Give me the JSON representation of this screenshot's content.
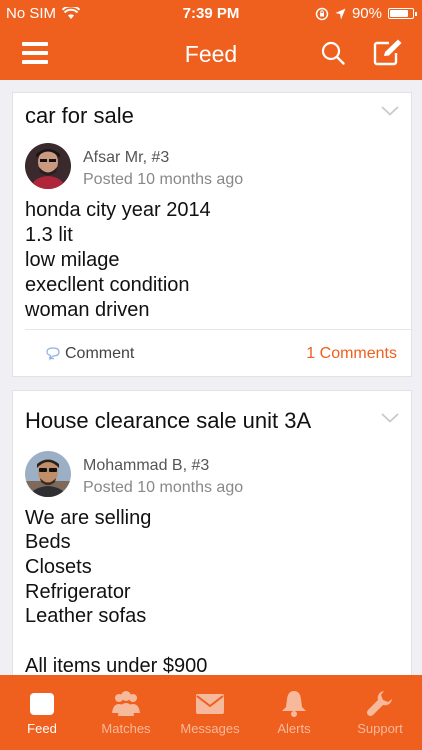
{
  "status": {
    "carrier": "No SIM",
    "time": "7:39 PM",
    "battery": "90%",
    "battery_level": 0.9
  },
  "nav": {
    "title": "Feed"
  },
  "posts": [
    {
      "title": "car for sale",
      "author": "Afsar Mr, #3",
      "posted": "Posted 10 months ago",
      "body": [
        "honda city year 2014",
        "1.3 lit",
        "low milage",
        "execllent condition",
        "woman driven"
      ],
      "comment_label": "Comment",
      "comments_count": "1 Comments"
    },
    {
      "title": "House clearance sale unit 3A",
      "author": "Mohammad B, #3",
      "posted": "Posted 10 months ago",
      "body": [
        "We are selling",
        "Beds",
        "Closets",
        "Refrigerator",
        "Leather sofas",
        "",
        "All items under $900"
      ]
    }
  ],
  "tabs": [
    {
      "label": "Feed",
      "icon": "feed-icon",
      "active": true
    },
    {
      "label": "Matches",
      "icon": "people-icon",
      "active": false
    },
    {
      "label": "Messages",
      "icon": "envelope-icon",
      "active": false
    },
    {
      "label": "Alerts",
      "icon": "bell-icon",
      "active": false
    },
    {
      "label": "Support",
      "icon": "wrench-icon",
      "active": false
    }
  ],
  "colors": {
    "accent": "#ef5f1d",
    "background": "#efeff4",
    "tab_inactive": "#f7b99b"
  }
}
